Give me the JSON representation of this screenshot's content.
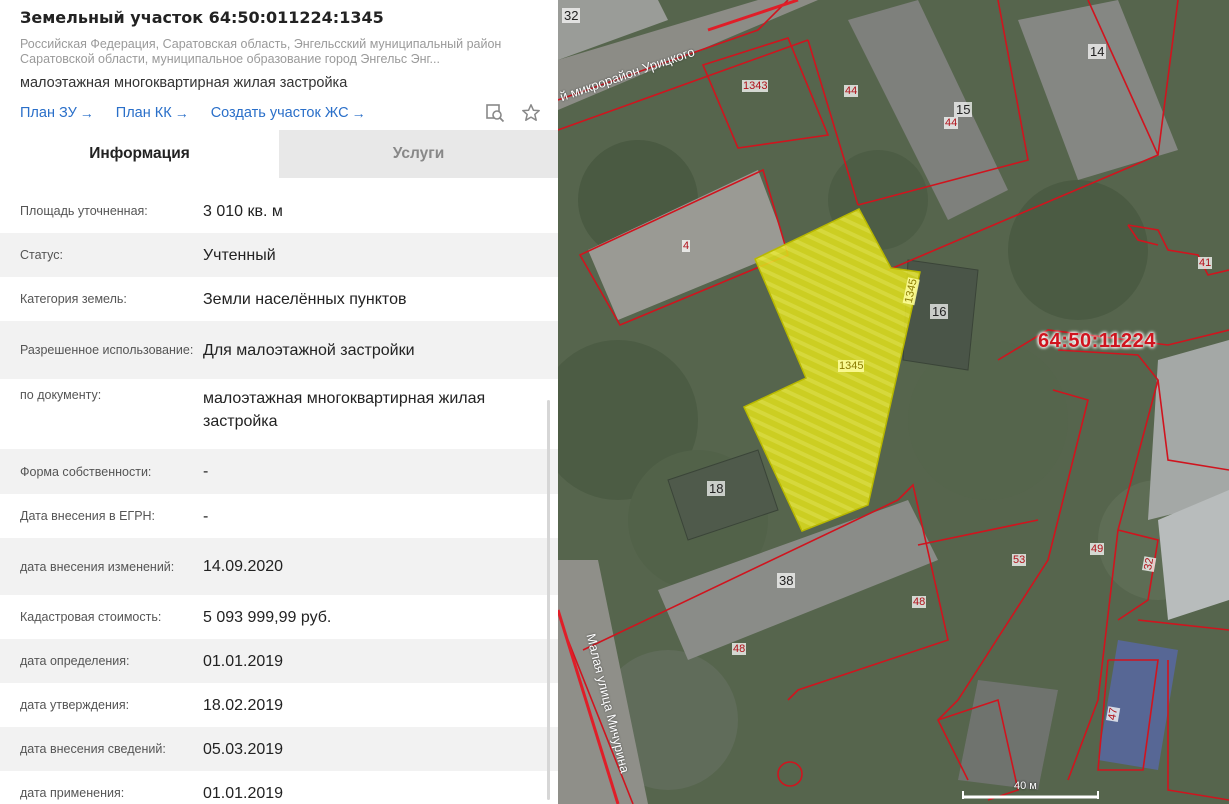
{
  "header": {
    "title": "Земельный участок 64:50:011224:1345",
    "address": "Российская Федерация, Саратовская область, Энгельсский муниципальный район Саратовской области, муниципальное образование город Энгельс Энг...",
    "subtitle": "малоэтажная многоквартирная жилая застройка",
    "links": [
      {
        "label": "План ЗУ"
      },
      {
        "label": "План КК"
      },
      {
        "label": "Создать участок ЖС"
      }
    ],
    "icons": [
      "map-search-icon",
      "star-icon"
    ]
  },
  "tabs": [
    {
      "label": "Информация",
      "active": true
    },
    {
      "label": "Услуги",
      "active": false
    }
  ],
  "info_rows": [
    {
      "label": "Площадь уточненная:",
      "value": "3 010 кв. м"
    },
    {
      "label": "Статус:",
      "value": "Учтенный"
    },
    {
      "label": "Категория земель:",
      "value": "Земли населённых пунктов"
    },
    {
      "label": "Разрешенное использование:",
      "value": "Для малоэтажной застройки"
    },
    {
      "label": "по документу:",
      "value": "малоэтажная многоквартирная жилая застройка"
    },
    {
      "label": "Форма собственности:",
      "value": "-"
    },
    {
      "label": "Дата внесения в ЕГРН:",
      "value": "-"
    },
    {
      "label": "дата внесения изменений:",
      "value": "14.09.2020"
    },
    {
      "label": "Кадастровая стоимость:",
      "value": "5 093 999,99 руб."
    },
    {
      "label": "дата определения:",
      "value": "01.01.2019"
    },
    {
      "label": "дата утверждения:",
      "value": "18.02.2019"
    },
    {
      "label": "дата внесения сведений:",
      "value": "05.03.2019"
    },
    {
      "label": "дата применения:",
      "value": "01.01.2019"
    }
  ],
  "map": {
    "quarter_label": "64:50:11224",
    "street_1": "й микрорайон Урицкого",
    "street_2": "Малая улица Мичурина",
    "scale": "40 м",
    "parcel_labels": [
      "1343",
      "44",
      "44",
      "4",
      "41",
      "1345",
      "1345",
      "53",
      "49",
      "32",
      "48",
      "48",
      "47"
    ],
    "building_labels": [
      "32",
      "14",
      "15",
      "16",
      "18",
      "38"
    ],
    "colors": {
      "highlight": "#e6e61e",
      "boundary": "#d0141e",
      "link": "#2a6fc9"
    }
  }
}
